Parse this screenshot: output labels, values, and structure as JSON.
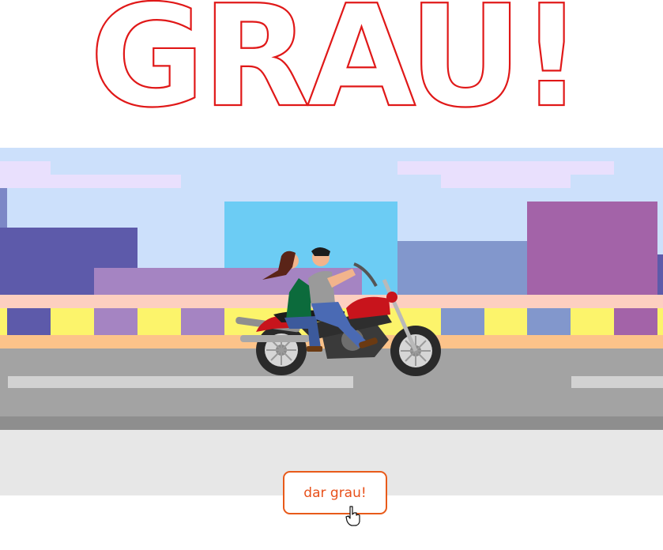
{
  "title": "GRAU!",
  "button": {
    "label": "dar grau!"
  },
  "colors": {
    "title_stroke": "#e01818",
    "button_accent": "#e8501a",
    "sky": "#cce0fb",
    "road": "#a3a3a3",
    "sidewalk": "#e7e7e7",
    "bike_red": "#c8141c",
    "rider_shirt_grey": "#9a9a9a",
    "passenger_shirt_green": "#0c6b3c"
  },
  "icons": {
    "cursor": "hand-pointer-icon"
  }
}
